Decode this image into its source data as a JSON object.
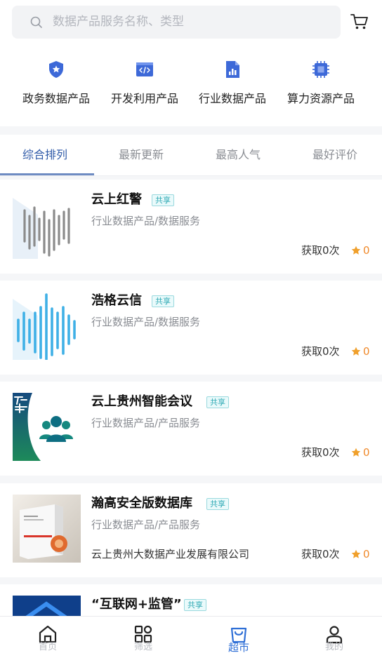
{
  "search": {
    "placeholder": "数据产品服务名称、类型"
  },
  "categories": [
    {
      "label": "政务数据产品",
      "icon": "shield-star-icon"
    },
    {
      "label": "开发利用产品",
      "icon": "code-window-icon"
    },
    {
      "label": "行业数据产品",
      "icon": "bar-chart-doc-icon"
    },
    {
      "label": "算力资源产品",
      "icon": "chip-icon"
    }
  ],
  "tabs": [
    {
      "label": "综合排列",
      "active": true
    },
    {
      "label": "最新更新",
      "active": false
    },
    {
      "label": "最高人气",
      "active": false
    },
    {
      "label": "最好评价",
      "active": false
    }
  ],
  "products": [
    {
      "name": "云上红警",
      "tag": "共享",
      "category": "行业数据产品/数据服务",
      "company": "",
      "count": "获取0次",
      "rating": "0"
    },
    {
      "name": "浩格云信",
      "tag": "共享",
      "category": "行业数据产品/数据服务",
      "company": "",
      "count": "获取0次",
      "rating": "0"
    },
    {
      "name": "云上贵州智能会议",
      "tag": "共享",
      "category": "行业数据产品/产品服务",
      "company": "",
      "count": "获取0次",
      "rating": "0"
    },
    {
      "name": "瀚高安全版数据库",
      "tag": "共享",
      "category": "行业数据产品/产品服务",
      "company": "云上贵州大数据产业发展有限公司",
      "count": "获取0次",
      "rating": "0"
    },
    {
      "name": "“互联网+监管”",
      "tag": "共享",
      "category": "",
      "company": "",
      "count": "",
      "rating": ""
    }
  ],
  "bottom_nav": [
    {
      "label": "首页",
      "icon": "home-icon",
      "active": false
    },
    {
      "label": "筛选",
      "icon": "grid-filter-icon",
      "active": false
    },
    {
      "label": "超市",
      "icon": "basket-icon",
      "active": true
    },
    {
      "label": "我的",
      "icon": "user-icon",
      "active": false
    }
  ],
  "colors": {
    "accent": "#2f5aa8",
    "nav_active": "#2f6fd6",
    "rating": "#f08a2c",
    "tag": "#2fa9b4"
  }
}
